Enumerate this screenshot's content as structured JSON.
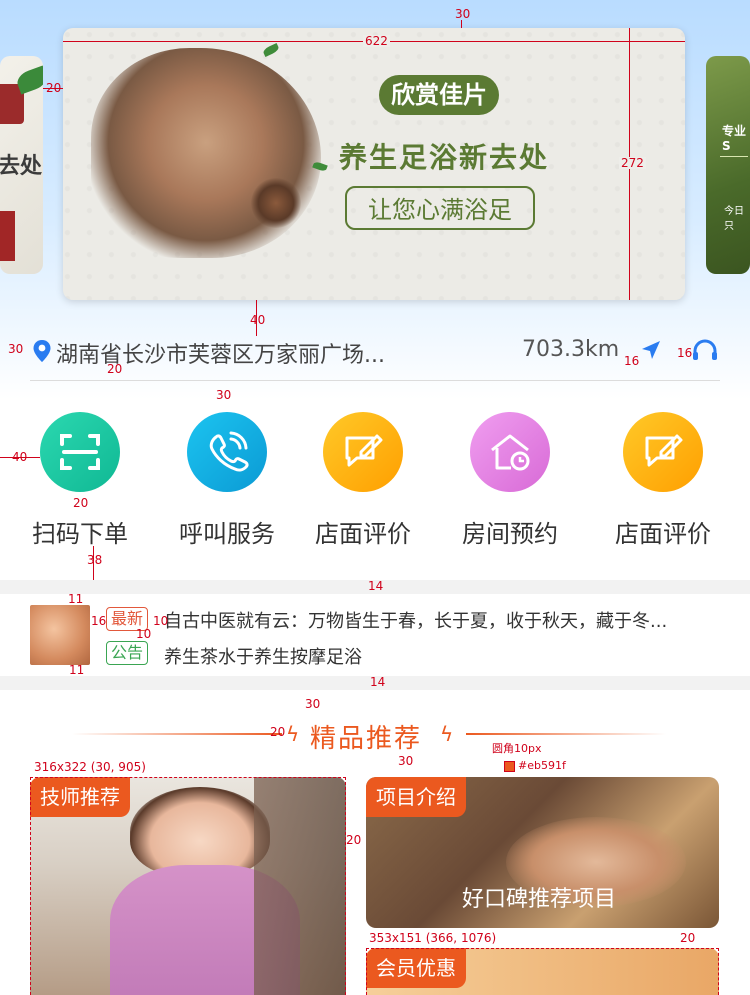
{
  "banner": {
    "tag": "欣赏佳片",
    "headline": "养生足浴新去处",
    "subline": "让您心满浴足",
    "left_peek_text": "去处",
    "right_peek_text": "专业S",
    "right_peek_sub": "今日只"
  },
  "location": {
    "address": "湖南省长沙市芙蓉区万家丽广场...",
    "distance": "703.3km"
  },
  "quick_actions": [
    {
      "label": "扫码下单",
      "icon": "scan-icon",
      "color": "#1ccaa0"
    },
    {
      "label": "呼叫服务",
      "icon": "phone-icon",
      "color": "#16b9e8"
    },
    {
      "label": "店面评价",
      "icon": "review-icon",
      "color": "#ffb400"
    },
    {
      "label": "房间预约",
      "icon": "home-clock-icon",
      "color": "#e98ae6"
    },
    {
      "label": "店面评价",
      "icon": "review-icon",
      "color": "#ffb400"
    }
  ],
  "notices": [
    {
      "tag": "最新",
      "text": "自古中医就有云：万物皆生于春，长于夏，收于秋天，藏于冬..."
    },
    {
      "tag": "公告",
      "text": "养生茶水于养生按摩足浴"
    }
  ],
  "section": {
    "title": "精品推荐"
  },
  "cards": {
    "technician": {
      "label": "技师推荐"
    },
    "project": {
      "label": "项目介绍",
      "caption": "好口碑推荐项目"
    },
    "member": {
      "label": "会员优惠"
    }
  },
  "accent_color": "#eb591f",
  "annotations": {
    "banner_top": "30",
    "banner_width": "622",
    "banner_height": "272",
    "banner_gap": "20",
    "banner_bottom": "40",
    "loc_left": "30",
    "loc_below": "20",
    "icon_left": "16",
    "icon_right": "16",
    "grid_top": "30",
    "icon_edge": "40",
    "icon_gap": "20",
    "label_below": "38",
    "thumb_top": "11",
    "thumb_bottom": "11",
    "tag_left": "16",
    "tag_right": "10",
    "tag_gap": "10",
    "band_gap_top": "14",
    "band_gap_bottom": "14",
    "section_top": "30",
    "deco_gap": "20",
    "radius_note": "圆角10px",
    "color_note": "#eb591f",
    "card_gap_top": "30",
    "left_card_dims": "316x322 (30, 905)",
    "card_col_gap": "20",
    "member_dims": "353x151 (366, 1076)",
    "member_gap": "20"
  }
}
